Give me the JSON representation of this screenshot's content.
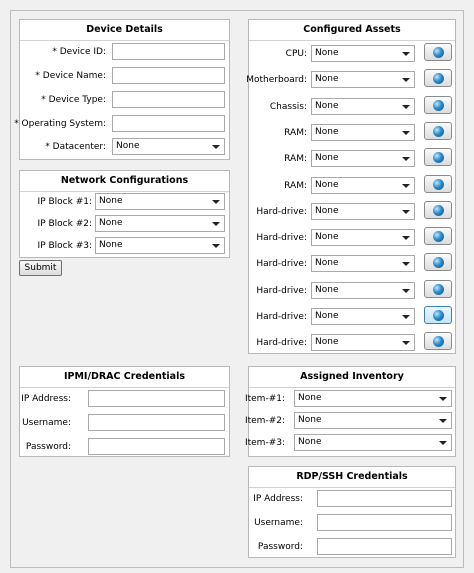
{
  "device_details": {
    "title": "Device Details",
    "fields": [
      {
        "label": "* Device ID:",
        "value": ""
      },
      {
        "label": "* Device Name:",
        "value": ""
      },
      {
        "label": "* Device Type:",
        "value": ""
      },
      {
        "label": "* Operating System:",
        "value": ""
      }
    ],
    "datacenter": {
      "label": "* Datacenter:",
      "value": "None"
    }
  },
  "network": {
    "title": "Network Configurations",
    "blocks": [
      {
        "label": "IP Block #1:",
        "value": "None"
      },
      {
        "label": "IP Block #2:",
        "value": "None"
      },
      {
        "label": "IP Block #3:",
        "value": "None"
      }
    ]
  },
  "submit_label": "Submit",
  "ipmi": {
    "title": "IPMI/DRAC Credentials",
    "fields": [
      {
        "label": "IP Address:",
        "value": ""
      },
      {
        "label": "Username:",
        "value": ""
      },
      {
        "label": "Password:",
        "value": ""
      }
    ]
  },
  "assets": {
    "title": "Configured Assets",
    "rows": [
      {
        "label": "CPU:",
        "value": "None"
      },
      {
        "label": "Motherboard:",
        "value": "None"
      },
      {
        "label": "Chassis:",
        "value": "None"
      },
      {
        "label": "RAM:",
        "value": "None"
      },
      {
        "label": "RAM:",
        "value": "None"
      },
      {
        "label": "RAM:",
        "value": "None"
      },
      {
        "label": "Hard-drive:",
        "value": "None"
      },
      {
        "label": "Hard-drive:",
        "value": "None"
      },
      {
        "label": "Hard-drive:",
        "value": "None"
      },
      {
        "label": "Hard-drive:",
        "value": "None"
      },
      {
        "label": "Hard-drive:",
        "value": "None"
      },
      {
        "label": "Hard-drive:",
        "value": "None"
      }
    ]
  },
  "inventory": {
    "title": "Assigned Inventory",
    "items": [
      {
        "label": "Item-#1:",
        "value": "None"
      },
      {
        "label": "Item-#2:",
        "value": "None"
      },
      {
        "label": "Item-#3:",
        "value": "None"
      }
    ]
  },
  "rdp": {
    "title": "RDP/SSH Credentials",
    "fields": [
      {
        "label": "IP Address:",
        "value": ""
      },
      {
        "label": "Username:",
        "value": ""
      },
      {
        "label": "Password:",
        "value": ""
      }
    ]
  },
  "icons": {
    "asset_lookup": "globe-icon"
  }
}
